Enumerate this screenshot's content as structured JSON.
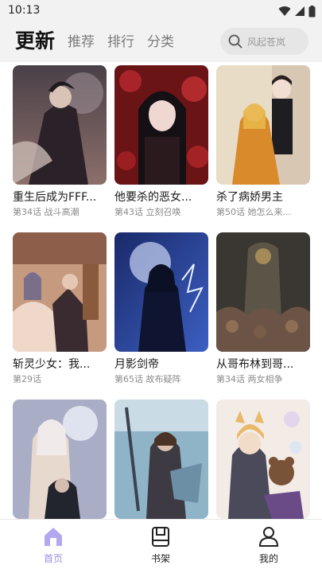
{
  "status_bar": {
    "time": "10:13"
  },
  "header": {
    "tabs": [
      {
        "label": "更新",
        "active": true
      },
      {
        "label": "推荐",
        "active": false
      },
      {
        "label": "排行",
        "active": false
      },
      {
        "label": "分类",
        "active": false
      }
    ],
    "search": {
      "placeholder": "风起苍岚"
    }
  },
  "comics": [
    {
      "title": "重生后成为FFF...",
      "subtitle": "第34话 战斗高潮"
    },
    {
      "title": "他要杀的恶女...",
      "subtitle": "第43话 立刻召唤"
    },
    {
      "title": "杀了病娇男主",
      "subtitle": "第50话 她怎么来..."
    },
    {
      "title": "斩灵少女：我...",
      "subtitle": "第29话"
    },
    {
      "title": "月影剑帝",
      "subtitle": "第65话 故布疑阵"
    },
    {
      "title": "从哥布林到哥...",
      "subtitle": "第34话 两女相争"
    },
    {
      "title": "",
      "subtitle": ""
    },
    {
      "title": "",
      "subtitle": ""
    },
    {
      "title": "",
      "subtitle": ""
    }
  ],
  "bottom_nav": [
    {
      "label": "首页",
      "active": true
    },
    {
      "label": "书架",
      "active": false
    },
    {
      "label": "我的",
      "active": false
    }
  ],
  "colors": {
    "accent": "#9b8de6",
    "background": "#ffffff",
    "header_bg": "#f2f2f2"
  }
}
